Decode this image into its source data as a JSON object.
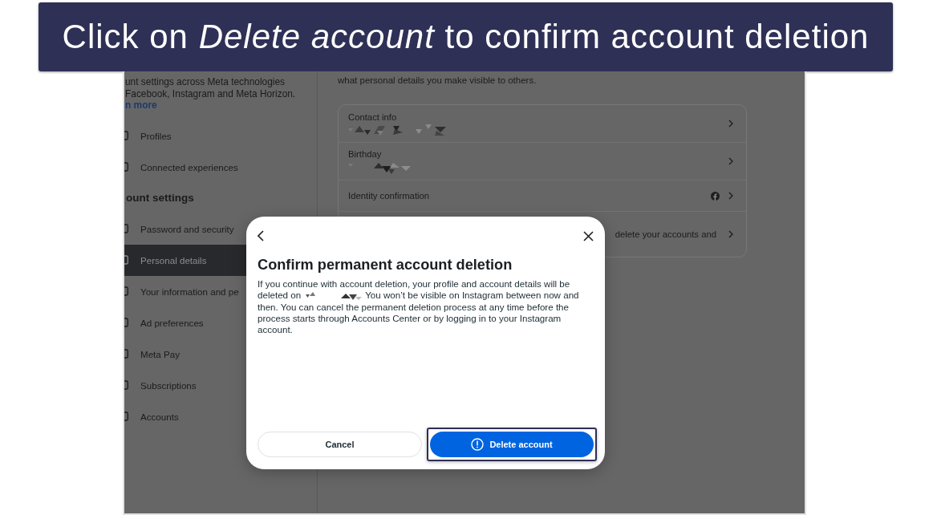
{
  "banner": {
    "text": "Click on *Delete account* to confirm account deletion"
  },
  "sidebar": {
    "description": [
      "unt settings across Meta technologies",
      "Facebook, Instagram and Meta Horizon."
    ],
    "link": "n more",
    "items": [
      {
        "label": "Profiles",
        "selected": false
      },
      {
        "label": "Connected experiences",
        "selected": false
      }
    ],
    "section": {
      "title": "ount settings",
      "items": [
        {
          "label": "Password and security",
          "selected": false
        },
        {
          "label": "Personal details",
          "selected": true
        },
        {
          "label": "Your information and pe",
          "selected": false
        },
        {
          "label": "Ad preferences",
          "selected": false
        },
        {
          "label": "Meta Pay",
          "selected": false
        },
        {
          "label": "Subscriptions",
          "selected": false
        },
        {
          "label": "Accounts",
          "selected": false
        }
      ]
    }
  },
  "details": {
    "intro": "what personal details you make visible to others.",
    "rows": [
      {
        "kind": "masked",
        "label": "Contact info"
      },
      {
        "kind": "masked",
        "label": "Birthday"
      },
      {
        "kind": "linked",
        "label": "Identity confirmation"
      },
      {
        "kind": "partial",
        "label": "delete your accounts and"
      }
    ]
  },
  "dialog": {
    "title": "Confirm permanent account deletion",
    "body": [
      "If you continue with account deletion, your profile and account details will be deleted on",
      "You won’t be visible on Instagram between now and then. You can cancel the permanent deletion process at any time before the process starts through Accounts Center or by logging in to your Instagram account."
    ],
    "buttons": [
      {
        "kind": "secondary",
        "label": "Cancel",
        "highlighted": false
      },
      {
        "kind": "primary",
        "label": "Delete account",
        "highlighted": true
      }
    ]
  }
}
